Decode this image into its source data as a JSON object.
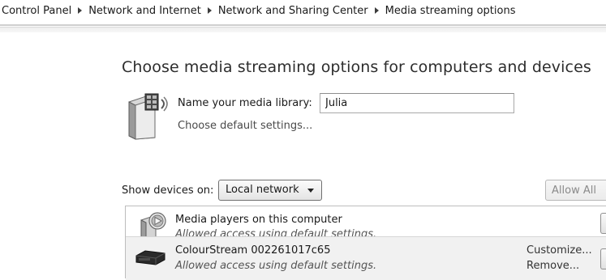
{
  "breadcrumb": {
    "items": [
      "Control Panel",
      "Network and Internet",
      "Network and Sharing Center",
      "Media streaming options"
    ]
  },
  "main": {
    "title": "Choose media streaming options for computers and devices",
    "library": {
      "label": "Name your media library:",
      "value": "Julia",
      "default_settings_link": "Choose default settings..."
    },
    "devices": {
      "show_label": "Show devices on:",
      "selected_network": "Local network",
      "allow_all_label": "Allow All",
      "items": [
        {
          "name": "Media players on this computer",
          "status": "Allowed access using default settings.",
          "icon": "media-player-icon"
        },
        {
          "name": "ColourStream 002261017c65",
          "status": "Allowed access using default settings.",
          "icon": "network-device-icon",
          "customize_label": "Customize...",
          "remove_label": "Remove..."
        }
      ]
    }
  }
}
